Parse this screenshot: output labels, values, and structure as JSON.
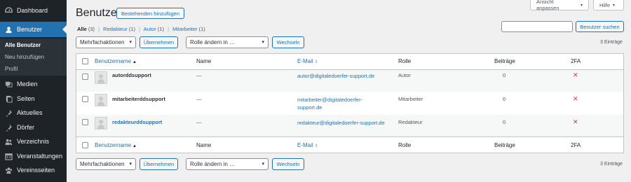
{
  "sidebar": {
    "items": [
      {
        "label": "Dashboard",
        "icon": "dashboard-icon"
      },
      {
        "label": "Benutzer",
        "icon": "users-icon"
      },
      {
        "label": "Medien",
        "icon": "media-icon"
      },
      {
        "label": "Seiten",
        "icon": "pages-icon"
      },
      {
        "label": "Aktuelles",
        "icon": "pin-icon"
      },
      {
        "label": "Dörfer",
        "icon": "pin-icon"
      },
      {
        "label": "Verzeichnis",
        "icon": "directory-icon"
      },
      {
        "label": "Veranstaltungen",
        "icon": "calendar-icon"
      },
      {
        "label": "Vereinsseiten",
        "icon": "groups-icon"
      }
    ],
    "submenu": [
      "Alle Benutzer",
      "Neu hinzufügen",
      "Profil"
    ]
  },
  "header": {
    "screen_options": "Ansicht anpassen",
    "help": "Hilfe",
    "title": "Benutzer",
    "add_existing": "Bestehenden hinzufügen"
  },
  "filters": {
    "all": "Alle",
    "all_count": "(3)",
    "redakteur": "Redakteur",
    "redakteur_count": "(1)",
    "autor": "Autor",
    "autor_count": "(1)",
    "mitarbeiter": "Mitarbeiter",
    "mitarbeiter_count": "(1)",
    "separator": "|"
  },
  "search": {
    "button": "Benutzer suchen",
    "value": ""
  },
  "bulk": {
    "actions": "Mehrfachaktionen",
    "apply": "Übernehmen",
    "change_role": "Rolle ändern in …",
    "change": "Wechseln",
    "count": "3 Einträge"
  },
  "table": {
    "columns": [
      "Benutzername",
      "Name",
      "E-Mail",
      "Rolle",
      "Beiträge",
      "2FA"
    ],
    "rows": [
      {
        "username": "autorddsupport",
        "name": "—",
        "email_1": "autor@digitaledoerfer-support.de",
        "email_2": "",
        "role": "Autor",
        "posts": "0",
        "twofa": "✕"
      },
      {
        "username": "mitarbeiterddsupport",
        "name": "—",
        "email_1": "mitarbeiter@digitaledoerfer-",
        "email_2": "support.de",
        "role": "Mitarbeiter",
        "posts": "0",
        "twofa": "✕"
      },
      {
        "username": "redakteurddsupport",
        "name": "—",
        "email_1": "redakteur@digitaledoerfer-support.de",
        "email_2": "",
        "role": "Redakteur",
        "posts": "0",
        "twofa": "✕"
      }
    ]
  },
  "colors": {
    "accent": "#2271b1",
    "sidebar": "#1d2327",
    "error": "#d63638"
  }
}
